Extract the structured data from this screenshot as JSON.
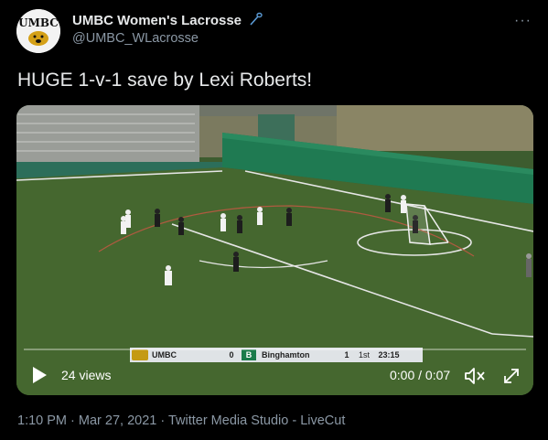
{
  "account": {
    "avatar_text": "UMBC",
    "name": "UMBC Women's Lacrosse",
    "name_icon": "lacrosse-stick-icon",
    "handle": "@UMBC_WLacrosse",
    "more_label": "···"
  },
  "tweet": {
    "text": "HUGE 1-v-1 save by Lexi Roberts!"
  },
  "video": {
    "scorebug": {
      "home_team": "UMBC",
      "home_score": "0",
      "away_logo": "B",
      "away_team": "Binghamton",
      "away_score": "1",
      "period": "1st",
      "clock": "23:15"
    },
    "progress": 0,
    "views": "24 views",
    "time": "0:00 / 0:07",
    "colors": {
      "field": "#3e5e30",
      "lines": "#e6e6e6",
      "banner": "#1f7a52"
    }
  },
  "meta": {
    "text": "1:10 PM · Mar 27, 2021 · Twitter Media Studio - LiveCut"
  }
}
